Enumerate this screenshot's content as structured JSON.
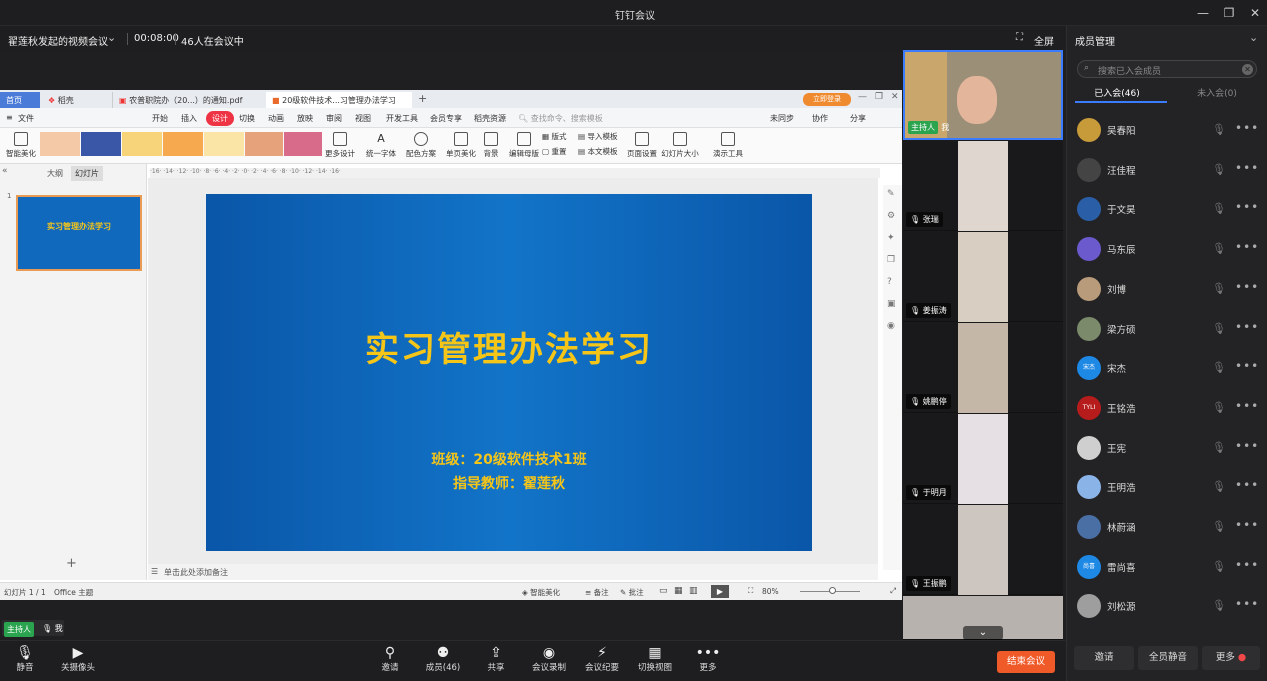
{
  "app": {
    "window_title": "钉钉会议"
  },
  "meeting": {
    "title": "翟莲秋发起的视频会议",
    "duration": "00:08:00",
    "participants_text": "46人在会议中",
    "fullscreen_label": "全屏"
  },
  "member_panel": {
    "title": "成员管理",
    "search_placeholder": "搜索已入会成员",
    "tab_joined": "已入会(46)",
    "tab_not_joined": "未入会(0)",
    "members": [
      {
        "name": "吴春阳",
        "color": "#c79a3a"
      },
      {
        "name": "汪佳程",
        "color": "#444444"
      },
      {
        "name": "于文昊",
        "color": "#2a5fa8"
      },
      {
        "name": "马东辰",
        "color": "#6a5acd"
      },
      {
        "name": "刘博",
        "color": "#b89b7a"
      },
      {
        "name": "梁方硕",
        "color": "#7a8a6a"
      },
      {
        "name": "宋杰",
        "color": "#1e88e5",
        "initial": "宋杰"
      },
      {
        "name": "王铭浩",
        "color": "#b71c1c",
        "initial": "TYLI"
      },
      {
        "name": "王宪",
        "color": "#cfcfcf"
      },
      {
        "name": "王明浩",
        "color": "#8ab4e8"
      },
      {
        "name": "林蔚涵",
        "color": "#4a6fa5"
      },
      {
        "name": "雷尚喜",
        "color": "#1e88e5",
        "initial": "尚喜"
      },
      {
        "name": "刘松源",
        "color": "#9e9e9e"
      }
    ],
    "invite_label": "邀请",
    "mute_all_label": "全员静音",
    "more_label": "更多"
  },
  "wps": {
    "tabs": [
      "首页",
      "稻壳",
      "农普职院办（20...）的通知.pdf",
      "20级软件技术...习管理办法学习"
    ],
    "tab_login": "立即登录",
    "menu": [
      "文件",
      "开始",
      "插入",
      "设计",
      "切换",
      "动画",
      "放映",
      "审阅",
      "视图",
      "开发工具",
      "会员专享",
      "稻壳资源"
    ],
    "menu_active": "设计",
    "search_placeholder": "查找命令、搜索模板",
    "right_menu": [
      "未同步",
      "协作",
      "分享"
    ],
    "tools": [
      "智能美化",
      "更多设计",
      "统一字体",
      "配色方案",
      "单页美化",
      "背景",
      "编辑母版",
      "版式",
      "重置",
      "导入模板",
      "本文模板",
      "页面设置",
      "幻灯片大小",
      "演示工具"
    ],
    "left_tabs": [
      "大纲",
      "幻灯片"
    ],
    "thumb_title": "实习管理办法学习",
    "slide": {
      "title": "实习管理办法学习",
      "line1": "班级：20级软件技术1班",
      "line2": "指导教师：翟莲秋"
    },
    "notes_placeholder": "单击此处添加备注",
    "status": {
      "slide_count": "幻灯片 1 / 1",
      "theme": "Office 主题",
      "smart": "智能美化",
      "notes": "备注",
      "comments": "批注",
      "zoom": "80%"
    },
    "ruler_text": "·16· ·14· ·12· ·10· ·8· ·6· ·4· ·2· ·0· ·2· ·4· ·6· ·8· ·10· ·12· ·14· ·16·"
  },
  "videos": [
    {
      "name": "我",
      "host_label": "主持人"
    },
    {
      "name": "张瑞"
    },
    {
      "name": "姜振涛"
    },
    {
      "name": "姚鹏停"
    },
    {
      "name": "于明月"
    },
    {
      "name": "王振鹏"
    }
  ],
  "self_badge": {
    "host_label": "主持人",
    "name": "我"
  },
  "controls": {
    "mute": "静音",
    "camera": "关摄像头",
    "invite": "邀请",
    "members": "成员(46)",
    "share": "共享",
    "record": "会议录制",
    "minutes": "会议纪要",
    "switch_view": "切换视图",
    "more": "更多",
    "end": "结束会议"
  }
}
